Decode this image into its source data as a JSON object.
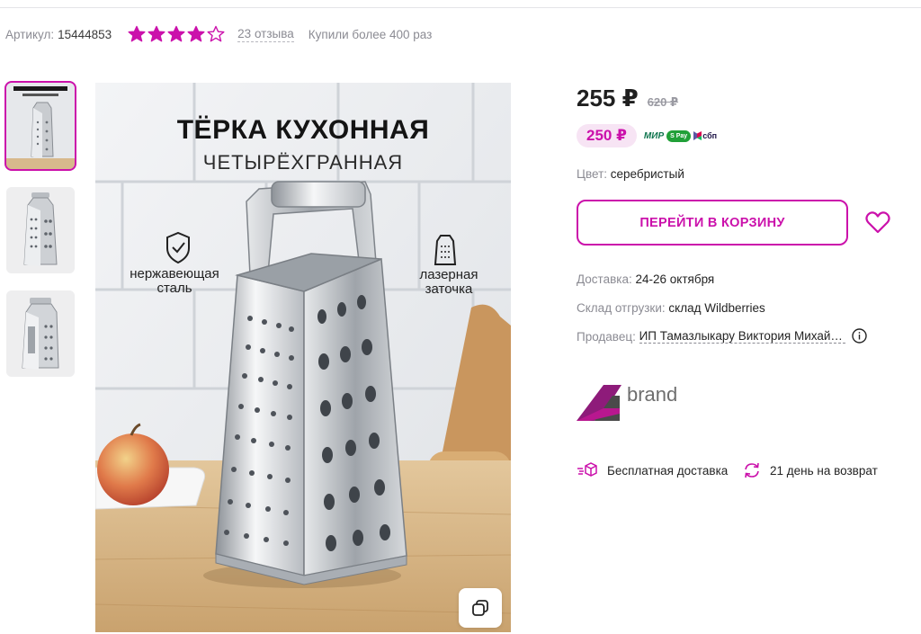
{
  "meta": {
    "article_label": "Артикул:",
    "article_value": "15444853",
    "rating_stars": 4,
    "reviews_link": "23 отзыва",
    "bought_text": "Купили более 400 раз"
  },
  "gallery": {
    "thumbnails": [
      "thumbnail-1",
      "thumbnail-2",
      "thumbnail-3"
    ],
    "active_index": 0
  },
  "main_image": {
    "title": "ТЁРКА КУХОННАЯ",
    "subtitle": "ЧЕТЫРЁХГРАННАЯ",
    "feature_left": "нержавеющая сталь",
    "feature_right": "лазерная заточка",
    "feature_left_icon": "shield-check-icon",
    "feature_right_icon": "grater-icon",
    "copy_icon": "copy-icon"
  },
  "pricing": {
    "price": "255 ₽",
    "old_price": "620 ₽",
    "wallet_price": "250 ₽",
    "pay_mir": "МИР",
    "pay_sberpay": "S Pay",
    "pay_sbp": "сбп"
  },
  "product": {
    "color_label": "Цвет:",
    "color_value": "серебристый",
    "cart_button": "ПЕРЕЙТИ В КОРЗИНУ",
    "delivery_label": "Доставка:",
    "delivery_value": "24-26 октября",
    "warehouse_label": "Склад отгрузки:",
    "warehouse_value": "склад Wildberries",
    "seller_label": "Продавец:",
    "seller_value": "ИП Тамазлыкару Виктория Михайловна"
  },
  "brand": {
    "name": "brand"
  },
  "perks": {
    "free_delivery": "Бесплатная доставка",
    "return_days": "21 день на возврат"
  },
  "colors": {
    "accent": "#cb11ab",
    "accent_light": "#f7e4f4",
    "muted": "#8b8b93"
  }
}
